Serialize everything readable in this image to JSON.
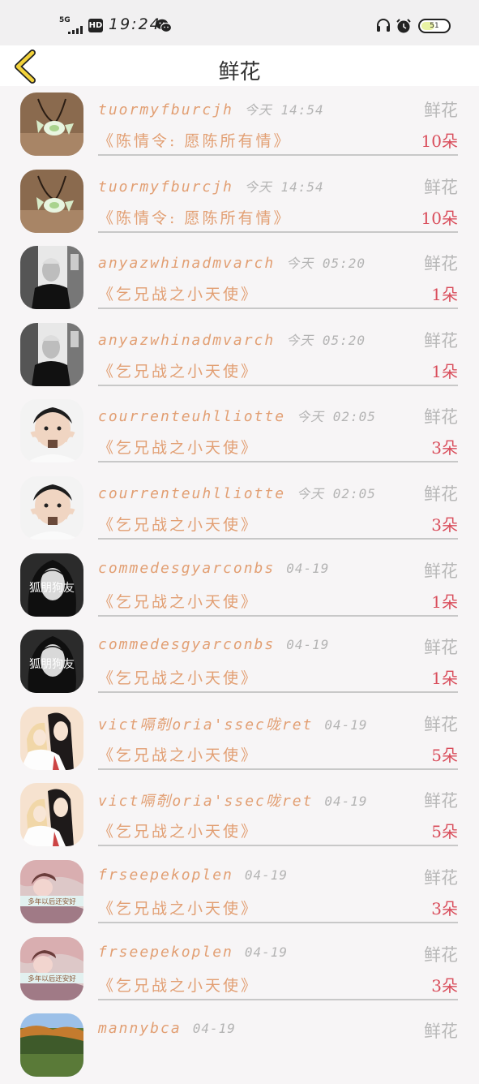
{
  "status_bar": {
    "network": "5G",
    "hd": "HD",
    "time": "19:24",
    "battery": "51",
    "battery_level": 0.51,
    "icons": [
      "signal-icon",
      "hd-icon",
      "wechat-icon",
      "headphone-icon",
      "alarm-icon",
      "battery-icon"
    ]
  },
  "header": {
    "back_icon": "chevron-left-icon",
    "title": "鲜花",
    "accent_color": "#f2d23a"
  },
  "colors": {
    "username": "#e29f73",
    "timestamp": "#b4b4b4",
    "count": "#d94d5b",
    "gift_type": "#b8b8b8"
  },
  "items": [
    {
      "username": "tuormyfburcjh",
      "time": "今天 14:54",
      "gift": "鲜花",
      "book": "《陈情令: 愿陈所有情》",
      "count": "10朵",
      "avatar": "candy-avatar"
    },
    {
      "username": "tuormyfburcjh",
      "time": "今天 14:54",
      "gift": "鲜花",
      "book": "《陈情令: 愿陈所有情》",
      "count": "10朵",
      "avatar": "candy-avatar"
    },
    {
      "username": "anyazwhinadmvarch",
      "time": "今天 05:20",
      "gift": "鲜花",
      "book": "《乞兄战之小天使》",
      "count": "1朵",
      "avatar": "man-avatar"
    },
    {
      "username": "anyazwhinadmvarch",
      "time": "今天 05:20",
      "gift": "鲜花",
      "book": "《乞兄战之小天使》",
      "count": "1朵",
      "avatar": "man-avatar"
    },
    {
      "username": "courrenteuhlliotte",
      "time": "今天 02:05",
      "gift": "鲜花",
      "book": "《乞兄战之小天使》",
      "count": "3朵",
      "avatar": "child-avatar"
    },
    {
      "username": "courrenteuhlliotte",
      "time": "今天 02:05",
      "gift": "鲜花",
      "book": "《乞兄战之小天使》",
      "count": "3朵",
      "avatar": "child-avatar"
    },
    {
      "username": "commedesgyarconbs",
      "time": "04-19",
      "gift": "鲜花",
      "book": "《乞兄战之小天使》",
      "count": "1朵",
      "avatar": "woman-avatar",
      "avatar_text": "狐朋狗友"
    },
    {
      "username": "commedesgyarconbs",
      "time": "04-19",
      "gift": "鲜花",
      "book": "《乞兄战之小天使》",
      "count": "1朵",
      "avatar": "woman-avatar",
      "avatar_text": "狐朋狗友"
    },
    {
      "username": "vict嗝剞oria'ssec咙ret",
      "time": "04-19",
      "gift": "鲜花",
      "book": "《乞兄战之小天使》",
      "count": "5朵",
      "avatar": "anime-avatar"
    },
    {
      "username": "vict嗝剞oria'ssec咙ret",
      "time": "04-19",
      "gift": "鲜花",
      "book": "《乞兄战之小天使》",
      "count": "5朵",
      "avatar": "anime-avatar"
    },
    {
      "username": "frseepekoplen",
      "time": "04-19",
      "gift": "鲜花",
      "book": "《乞兄战之小天使》",
      "count": "3朵",
      "avatar": "girl-avatar",
      "avatar_text": "多年以后还安好"
    },
    {
      "username": "frseepekoplen",
      "time": "04-19",
      "gift": "鲜花",
      "book": "《乞兄战之小天使》",
      "count": "3朵",
      "avatar": "girl-avatar",
      "avatar_text": "多年以后还安好"
    },
    {
      "username": "mannybca",
      "time": "04-19",
      "gift": "鲜花",
      "book": "",
      "count": "",
      "avatar": "landscape-avatar"
    }
  ]
}
